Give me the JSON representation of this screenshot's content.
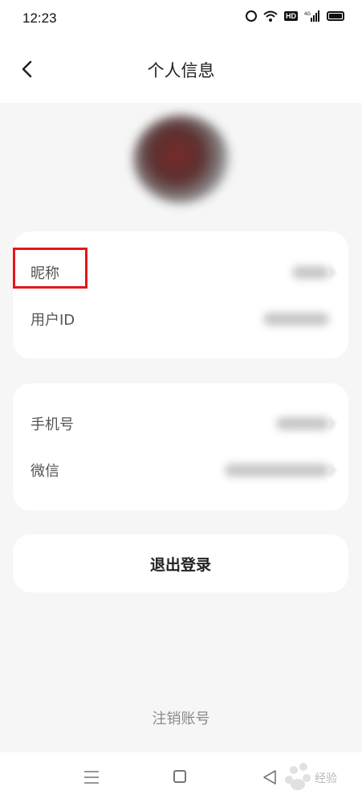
{
  "status_bar": {
    "time": "12:23",
    "hd_label": "HD",
    "network_label": "4G"
  },
  "header": {
    "title": "个人信息"
  },
  "profile_card": {
    "rows": [
      {
        "label": "昵称"
      },
      {
        "label": "用户ID"
      }
    ]
  },
  "account_card": {
    "rows": [
      {
        "label": "手机号"
      },
      {
        "label": "微信"
      }
    ]
  },
  "actions": {
    "logout_label": "退出登录",
    "cancel_account_label": "注销账号"
  },
  "watermark": {
    "text": "经验"
  },
  "colors": {
    "highlight": "#e4161b",
    "background": "#f6f6f6",
    "card": "#ffffff"
  },
  "icons": [
    "alarm-icon",
    "wifi-icon",
    "signal-icon",
    "battery-icon",
    "back-arrow-icon",
    "chevron-right-icon",
    "menu-icon",
    "home-icon",
    "back-triangle-icon"
  ]
}
